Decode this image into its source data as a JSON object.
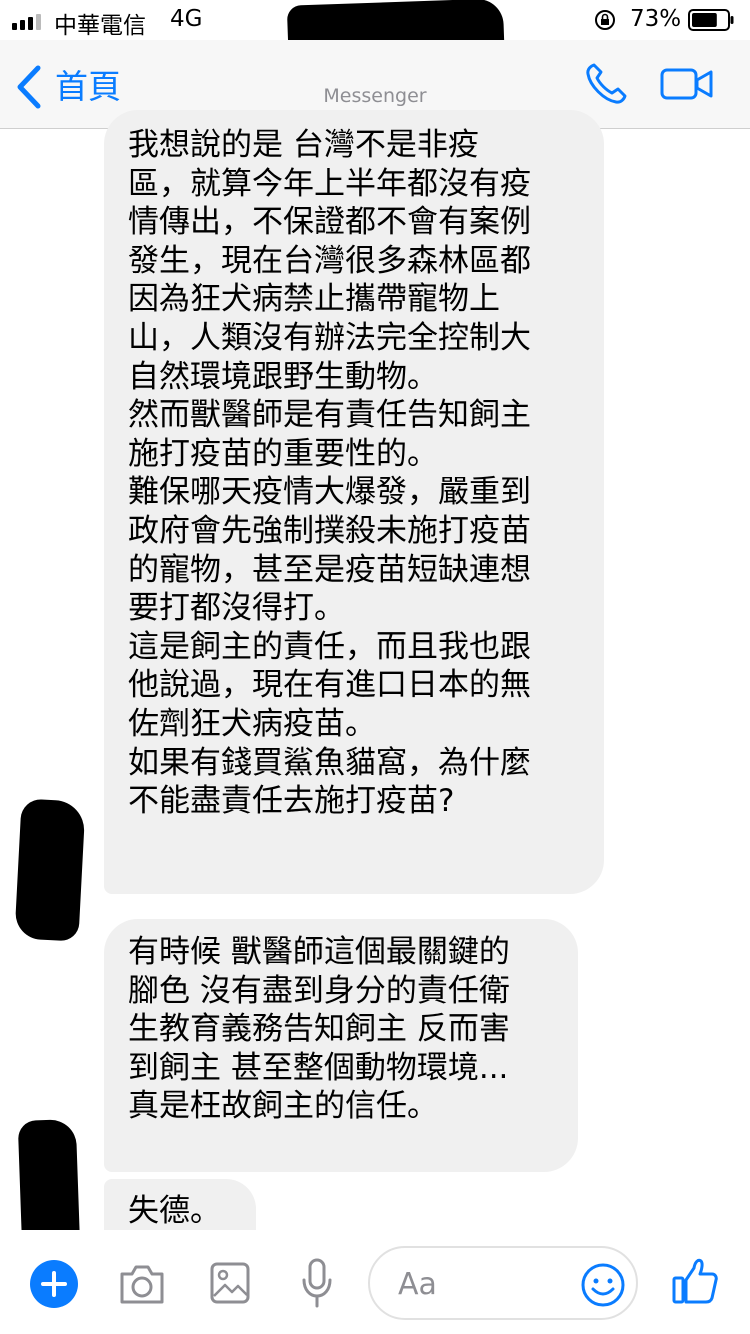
{
  "status_bar": {
    "carrier": "中華電信",
    "network": "4G",
    "battery_percent": "73%",
    "battery_level": 0.73
  },
  "nav": {
    "back_label": "首頁",
    "subtitle": "Messenger"
  },
  "messages": [
    {
      "paragraphs": [
        "我想說的是 台灣不是非疫\n區，就算今年上半年都沒有疫\n情傳出，不保證都不會有案例\n發生，現在台灣很多森林區都\n因為狂犬病禁止攜帶寵物上\n山，人類沒有辦法完全控制大\n自然環境跟野生動物。",
        "然而獸醫師是有責任告知飼主\n施打疫苗的重要性的。",
        "難保哪天疫情大爆發，嚴重到\n政府會先強制撲殺未施打疫苗\n的寵物，甚至是疫苗短缺連想\n要打都沒得打。",
        "這是飼主的責任，而且我也跟\n他說過，現在有進口日本的無\n佐劑狂犬病疫苗。",
        "如果有錢買鯊魚貓窩，為什麼\n不能盡責任去施打疫苗?"
      ]
    },
    {
      "paragraphs": [
        "有時候 獸醫師這個最關鍵的\n腳色 沒有盡到身分的責任衛\n生教育義務告知飼主 反而害\n到飼主 甚至整個動物環境...\n真是枉故飼主的信任。"
      ]
    },
    {
      "paragraphs": [
        "失德。"
      ]
    }
  ],
  "composer": {
    "placeholder": "Aa"
  },
  "colors": {
    "accent": "#0a7cff",
    "bubble": "#f0f0f0",
    "nav_bg": "#f7f7f7"
  },
  "icons": [
    "signal-icon",
    "lock-rotation-icon",
    "battery-icon",
    "back-chevron-icon",
    "phone-icon",
    "video-camera-icon",
    "add-icon",
    "camera-icon",
    "photo-icon",
    "microphone-icon",
    "emoji-icon",
    "thumbs-up-icon"
  ]
}
